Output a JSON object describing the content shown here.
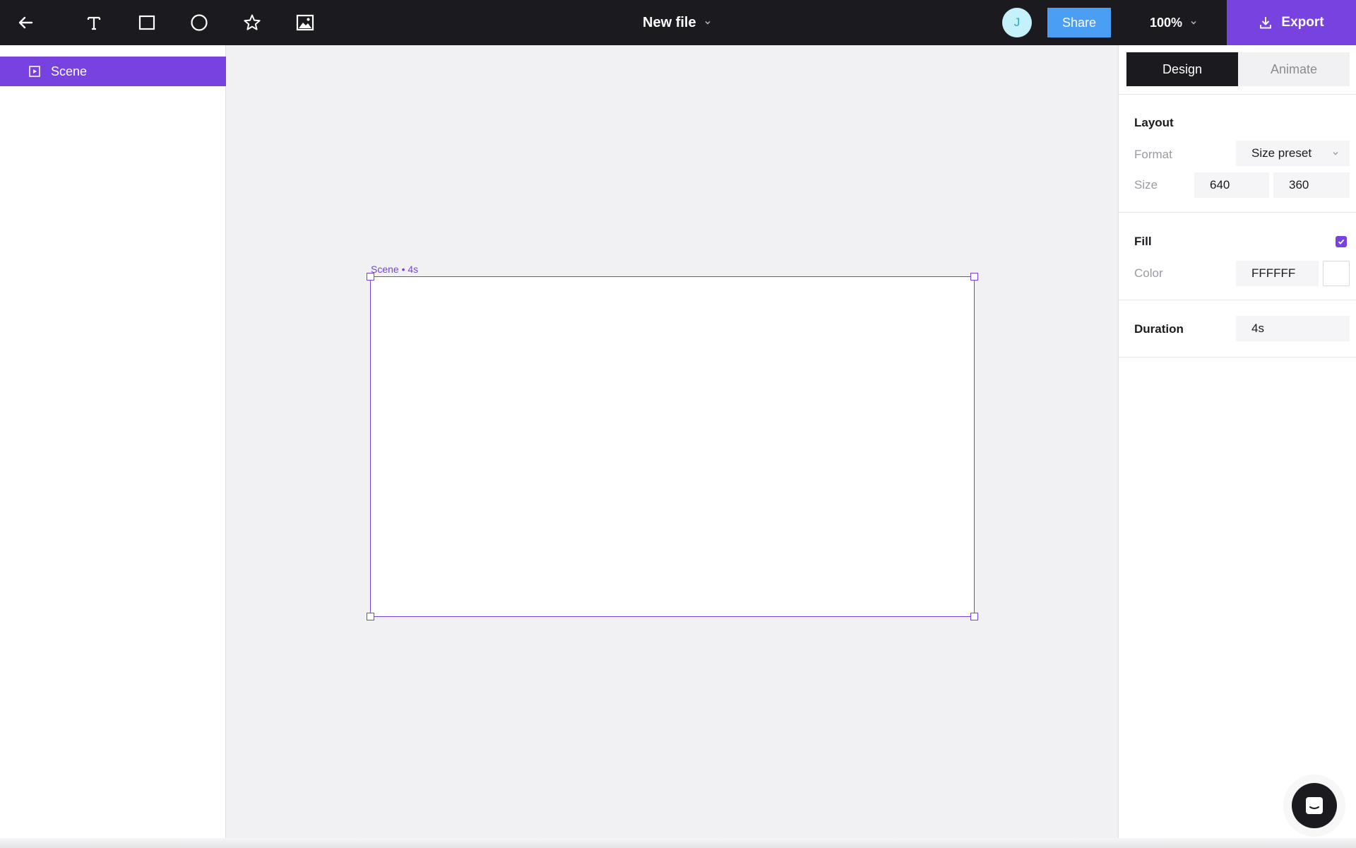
{
  "toolbar": {
    "tools": [
      {
        "icon": "back-arrow-icon"
      },
      {
        "icon": "text-tool-icon"
      },
      {
        "icon": "rectangle-tool-icon"
      },
      {
        "icon": "ellipse-tool-icon"
      },
      {
        "icon": "star-tool-icon"
      },
      {
        "icon": "image-tool-icon"
      }
    ],
    "file_title": "New file",
    "avatar_initial": "J",
    "share_label": "Share",
    "zoom": "100%",
    "export_label": "Export"
  },
  "layers": {
    "items": [
      {
        "label": "Scene",
        "selected": true
      }
    ]
  },
  "canvas": {
    "scene_label": "Scene • 4s",
    "scene_fill": "#FFFFFF",
    "selection_color": "#7742E0"
  },
  "panel": {
    "tabs": [
      {
        "label": "Design",
        "active": true
      },
      {
        "label": "Animate",
        "active": false
      }
    ],
    "layout": {
      "title": "Layout",
      "format_label": "Format",
      "format_value": "Size preset",
      "size_label": "Size",
      "width": "640",
      "height": "360"
    },
    "fill": {
      "title": "Fill",
      "enabled": true,
      "color_label": "Color",
      "color_value": "FFFFFF"
    },
    "duration": {
      "title": "Duration",
      "value": "4s"
    }
  },
  "colors": {
    "accent": "#7742E0",
    "topbar": "#1B1A1F",
    "share": "#4A9FF5",
    "avatar_bg": "#C5F1FB"
  }
}
